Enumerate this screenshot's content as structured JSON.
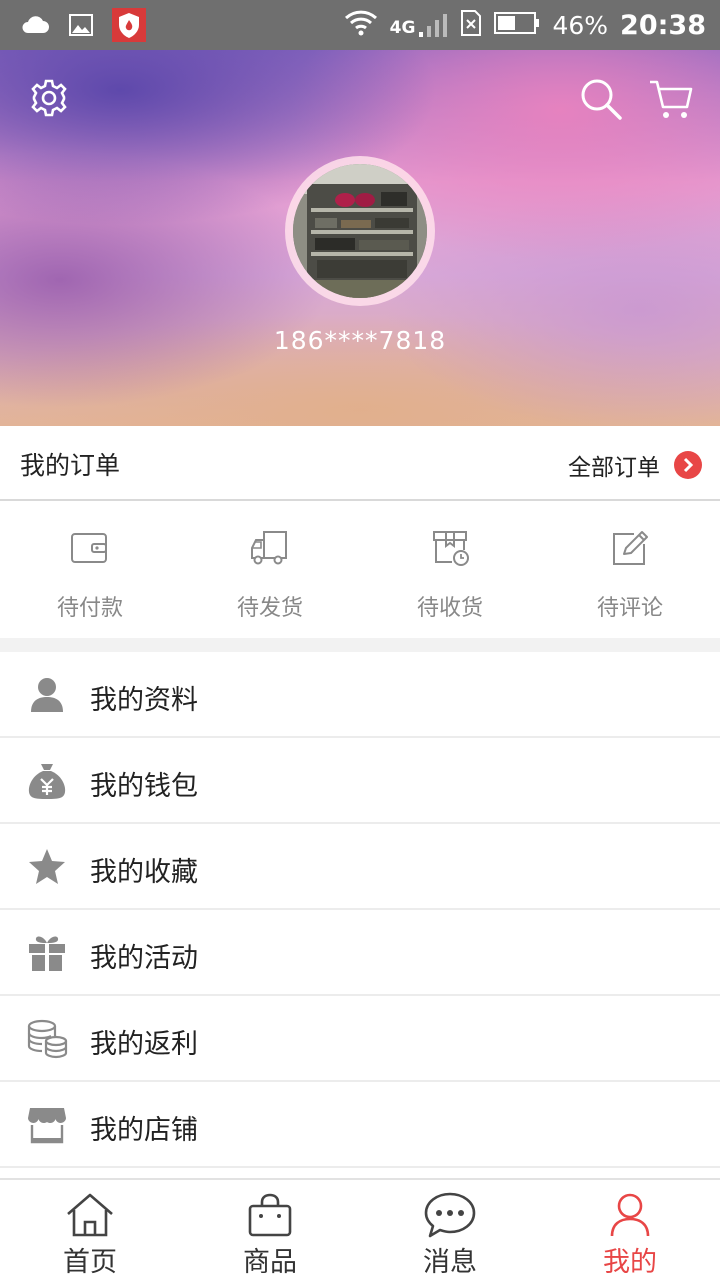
{
  "status_bar": {
    "network": "4G",
    "battery": "46%",
    "time": "20:38"
  },
  "profile": {
    "phone": "186****7818"
  },
  "orders": {
    "title": "我的订单",
    "all_label": "全部订单",
    "statuses": [
      {
        "label": "待付款",
        "icon": "wallet-icon"
      },
      {
        "label": "待发货",
        "icon": "truck-icon"
      },
      {
        "label": "待收货",
        "icon": "package-clock-icon"
      },
      {
        "label": "待评论",
        "icon": "edit-icon"
      }
    ]
  },
  "menu": [
    {
      "label": "我的资料",
      "icon": "user-icon"
    },
    {
      "label": "我的钱包",
      "icon": "money-bag-icon"
    },
    {
      "label": "我的收藏",
      "icon": "star-icon"
    },
    {
      "label": "我的活动",
      "icon": "gift-icon"
    },
    {
      "label": "我的返利",
      "icon": "coins-icon"
    },
    {
      "label": "我的店铺",
      "icon": "store-icon"
    }
  ],
  "bottom_nav": [
    {
      "label": "首页",
      "icon": "home-icon"
    },
    {
      "label": "商品",
      "icon": "shopping-bag-icon"
    },
    {
      "label": "消息",
      "icon": "chat-icon"
    },
    {
      "label": "我的",
      "icon": "person-icon",
      "active": true
    }
  ],
  "colors": {
    "accent": "#e84646",
    "status_bar": "#6f6f6f",
    "icon_gray": "#8a8a8a"
  }
}
